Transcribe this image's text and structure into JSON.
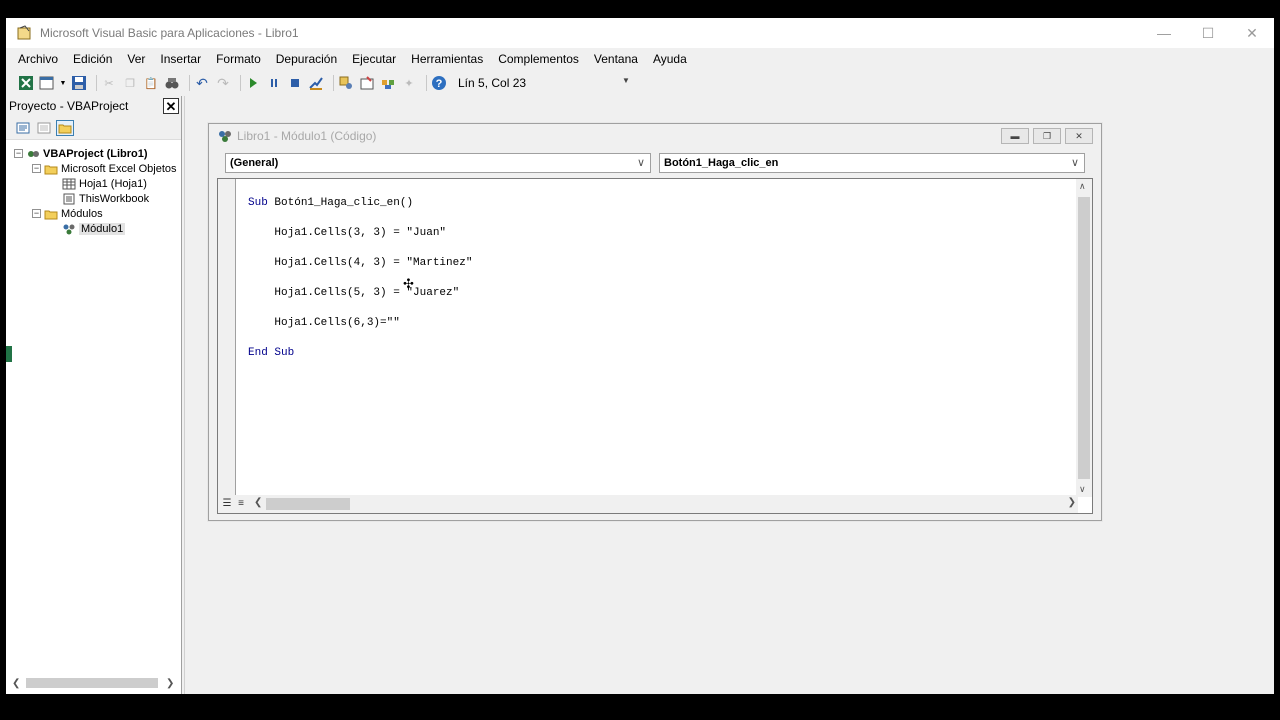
{
  "window": {
    "title": "Microsoft Visual Basic para Aplicaciones - Libro1"
  },
  "menu": [
    "Archivo",
    "Edición",
    "Ver",
    "Insertar",
    "Formato",
    "Depuración",
    "Ejecutar",
    "Herramientas",
    "Complementos",
    "Ventana",
    "Ayuda"
  ],
  "toolbar": {
    "status": "Lín 5, Col 23"
  },
  "project": {
    "title": "Proyecto - VBAProject",
    "tree": {
      "root": "VBAProject (Libro1)",
      "excel_objects": "Microsoft Excel Objetos",
      "sheet1": "Hoja1 (Hoja1)",
      "workbook": "ThisWorkbook",
      "modules": "Módulos",
      "module1": "Módulo1"
    }
  },
  "codewindow": {
    "title": "Libro1 - Módulo1 (Código)",
    "object_combo": "(General)",
    "proc_combo": "Botón1_Haga_clic_en",
    "lines": [
      "Sub Botón1_Haga_clic_en()",
      "    Hoja1.Cells(3, 3) = \"Juan\"",
      "    Hoja1.Cells(4, 3) = \"Martinez\"",
      "    Hoja1.Cells(5, 3) = \"Juarez\"",
      "    Hoja1.Cells(6,3)=\"\"",
      "End Sub"
    ]
  },
  "colors": {
    "accent": "#217346",
    "keyword": "#00008b"
  }
}
